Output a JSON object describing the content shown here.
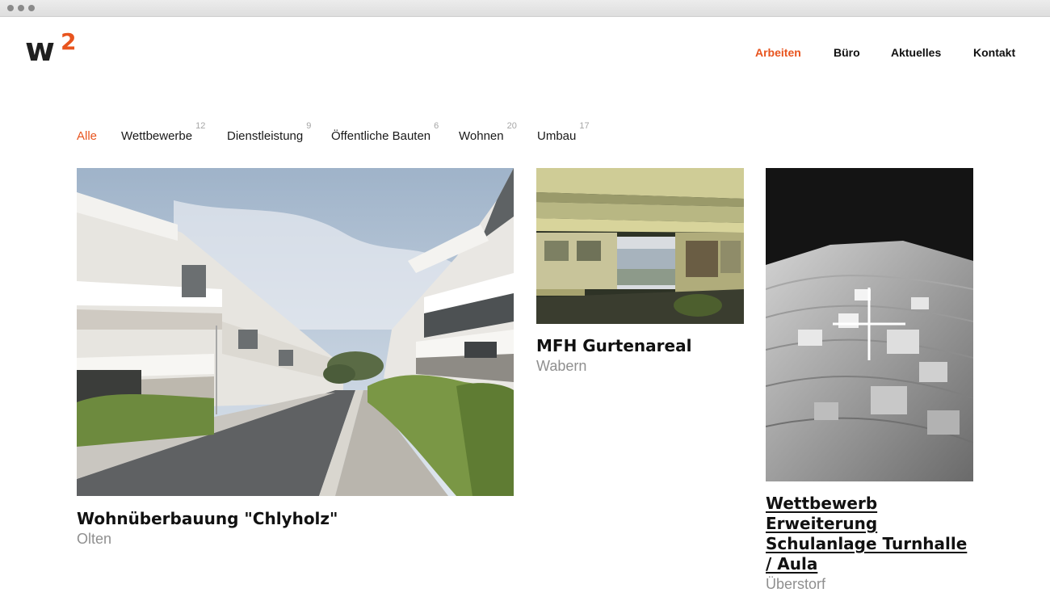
{
  "colors": {
    "accent": "#e8541e",
    "text": "#111111",
    "muted": "#8f8f8f",
    "count": "#a6a6a6"
  },
  "logo": {
    "letter": "w",
    "superscript": "2"
  },
  "nav": [
    {
      "label": "Arbeiten",
      "active": true
    },
    {
      "label": "Büro",
      "active": false
    },
    {
      "label": "Aktuelles",
      "active": false
    },
    {
      "label": "Kontakt",
      "active": false
    }
  ],
  "filters": [
    {
      "label": "Alle",
      "count": "",
      "active": true
    },
    {
      "label": "Wettbewerbe",
      "count": "12",
      "active": false
    },
    {
      "label": "Dienstleistung",
      "count": "9",
      "active": false
    },
    {
      "label": "Öffentliche Bauten",
      "count": "6",
      "active": false
    },
    {
      "label": "Wohnen",
      "count": "20",
      "active": false
    },
    {
      "label": "Umbau",
      "count": "17",
      "active": false
    }
  ],
  "projects": [
    {
      "title": "Wohnüberbauung \"Chlyholz\"",
      "location": "Olten",
      "image_icon": "residential-street-photo"
    },
    {
      "title": "MFH Gurtenareal",
      "location": "Wabern",
      "image_icon": "apartment-building-photo"
    },
    {
      "title": "Wettbewerb Erweiterung Schulanlage Turnhalle / Aula",
      "location": "Überstorf",
      "image_icon": "architectural-model-photo",
      "hover_icon": "plus-icon"
    }
  ]
}
